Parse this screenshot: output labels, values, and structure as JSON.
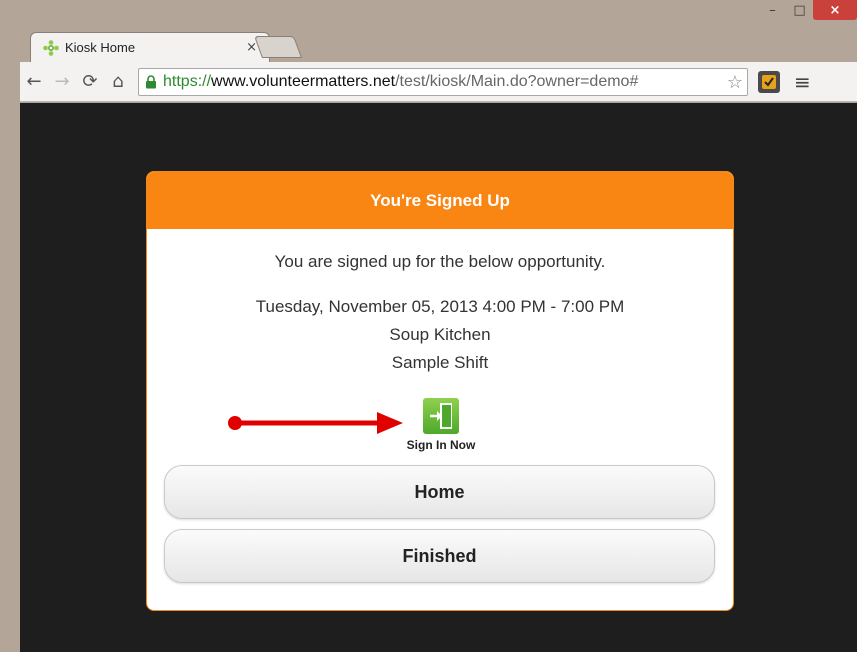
{
  "browser": {
    "tab_title": "Kiosk Home",
    "tab_close": "×",
    "url_proto": "https://",
    "url_host": "www.volunteermatters.net",
    "url_path": "/test/kiosk/Main.do?owner=demo#"
  },
  "window_controls": {
    "minimize": "–",
    "maximize": "□",
    "close": "×"
  },
  "card": {
    "header": "You're Signed Up",
    "intro": "You are signed up for the below opportunity.",
    "datetime": "Tuesday, November 05, 2013 4:00 PM - 7:00 PM",
    "opportunity": "Soup Kitchen",
    "shift": "Sample Shift",
    "signin_label": "Sign In Now",
    "home_button": "Home",
    "finished_button": "Finished"
  },
  "colors": {
    "accent": "#f98512",
    "signin_green": "#5cb531",
    "annotation_arrow": "#e00000"
  }
}
